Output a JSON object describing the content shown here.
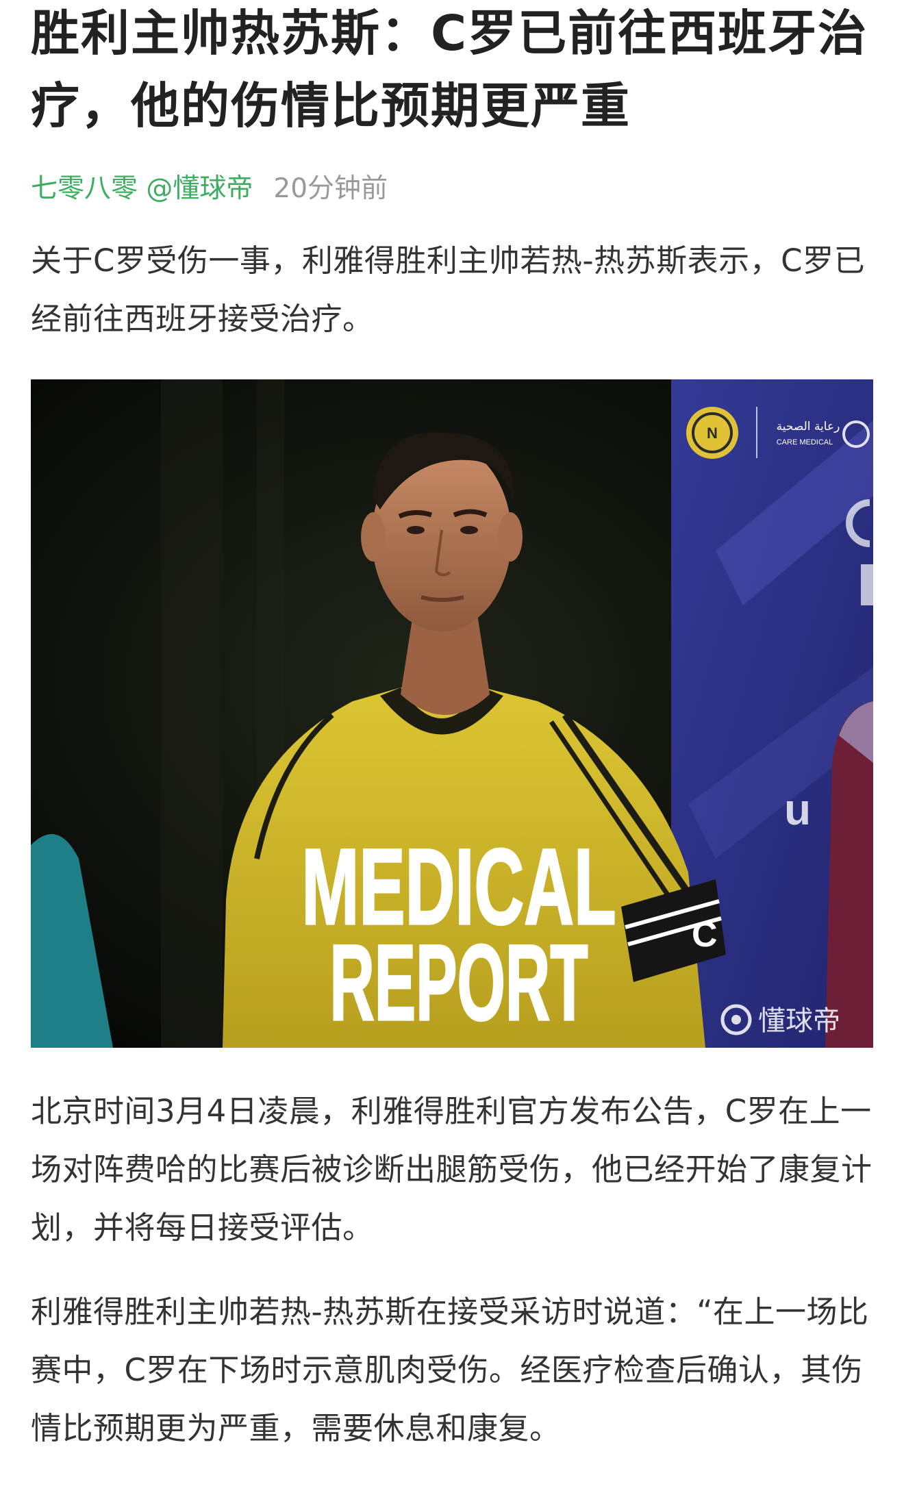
{
  "article": {
    "title": "胜利主帅热苏斯：C罗已前往西班牙治疗，他的伤情比预期更严重",
    "author": "七零八零 @懂球帝",
    "time": "20分钟前",
    "paragraphs": [
      "关于C罗受伤一事，利雅得胜利主帅若热-热苏斯表示，C罗已经前往西班牙接受治疗。",
      "北京时间3月4日凌晨，利雅得胜利官方发布公告，C罗在上一场对阵费哈的比赛后被诊断出腿筋受伤，他已经开始了康复计划，并将每日接受评估。",
      "利雅得胜利主帅若热-热苏斯在接受采访时说道：“在上一场比赛中，C罗在下场时示意肌肉受伤。经医疗检查后确认，其伤情比预期更为严重，需要休息和康复。"
    ]
  },
  "image": {
    "headline_line1": "MEDICAL",
    "headline_line2": "REPORT",
    "sponsor_text": "رعاية الصحية",
    "sponsor_text2": "CARE MEDICAL",
    "club_badge_text": "NASSR",
    "armband_text": "C",
    "watermark": "懂球帝"
  },
  "colors": {
    "author_green": "#3cae5f",
    "jersey_yellow": "#d6c030",
    "banner_blue": "#2c2f8a"
  }
}
